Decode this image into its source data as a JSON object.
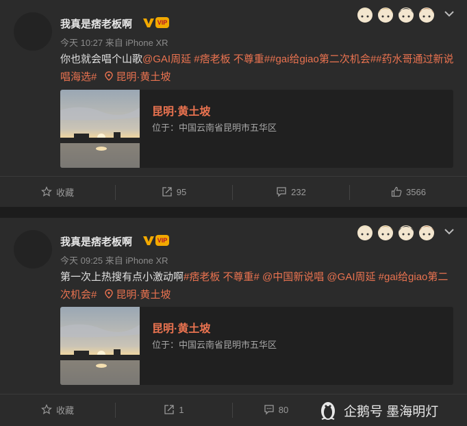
{
  "posts": [
    {
      "author": "我真是痞老板啊",
      "time": "今天 10:27 来自 iPhone XR",
      "text_plain": "你也就会唱个山歌",
      "text_hl": "@GAI周延 #痞老板 不尊重##gai给giao第二次机会##药水哥通过新说唱海选#",
      "location_inline": "昆明·黄土坡",
      "location_title": "昆明·黄土坡",
      "location_address": "位于：中国云南省昆明市五华区",
      "actions": {
        "favorite": "收藏",
        "repost": "95",
        "comment": "232",
        "like": "3566"
      }
    },
    {
      "author": "我真是痞老板啊",
      "time": "今天 09:25 来自 iPhone XR",
      "text_plain": "第一次上热搜有点小激动啊",
      "text_hl": "#痞老板 不尊重# @中国新说唱 @GAI周延 #gai给giao第二次机会#",
      "location_inline": "昆明·黄土坡",
      "location_title": "昆明·黄土坡",
      "location_address": "位于：中国云南省昆明市五华区",
      "actions": {
        "favorite": "收藏",
        "repost": "1",
        "comment": "80",
        "like": ""
      }
    }
  ],
  "badges": {
    "vip": "VIP"
  },
  "watermark": "企鹅号 墨海明灯",
  "icons": [
    "verified-v-icon",
    "vip-crown-icon",
    "chevron-down-icon",
    "location-pin-icon",
    "star-icon",
    "repost-icon",
    "comment-icon",
    "like-icon",
    "penguin-icon"
  ],
  "colors": {
    "background": "#1c1c1c",
    "card": "#2b2b2b",
    "accent": "#eb7350",
    "verified": "#f2a900"
  }
}
